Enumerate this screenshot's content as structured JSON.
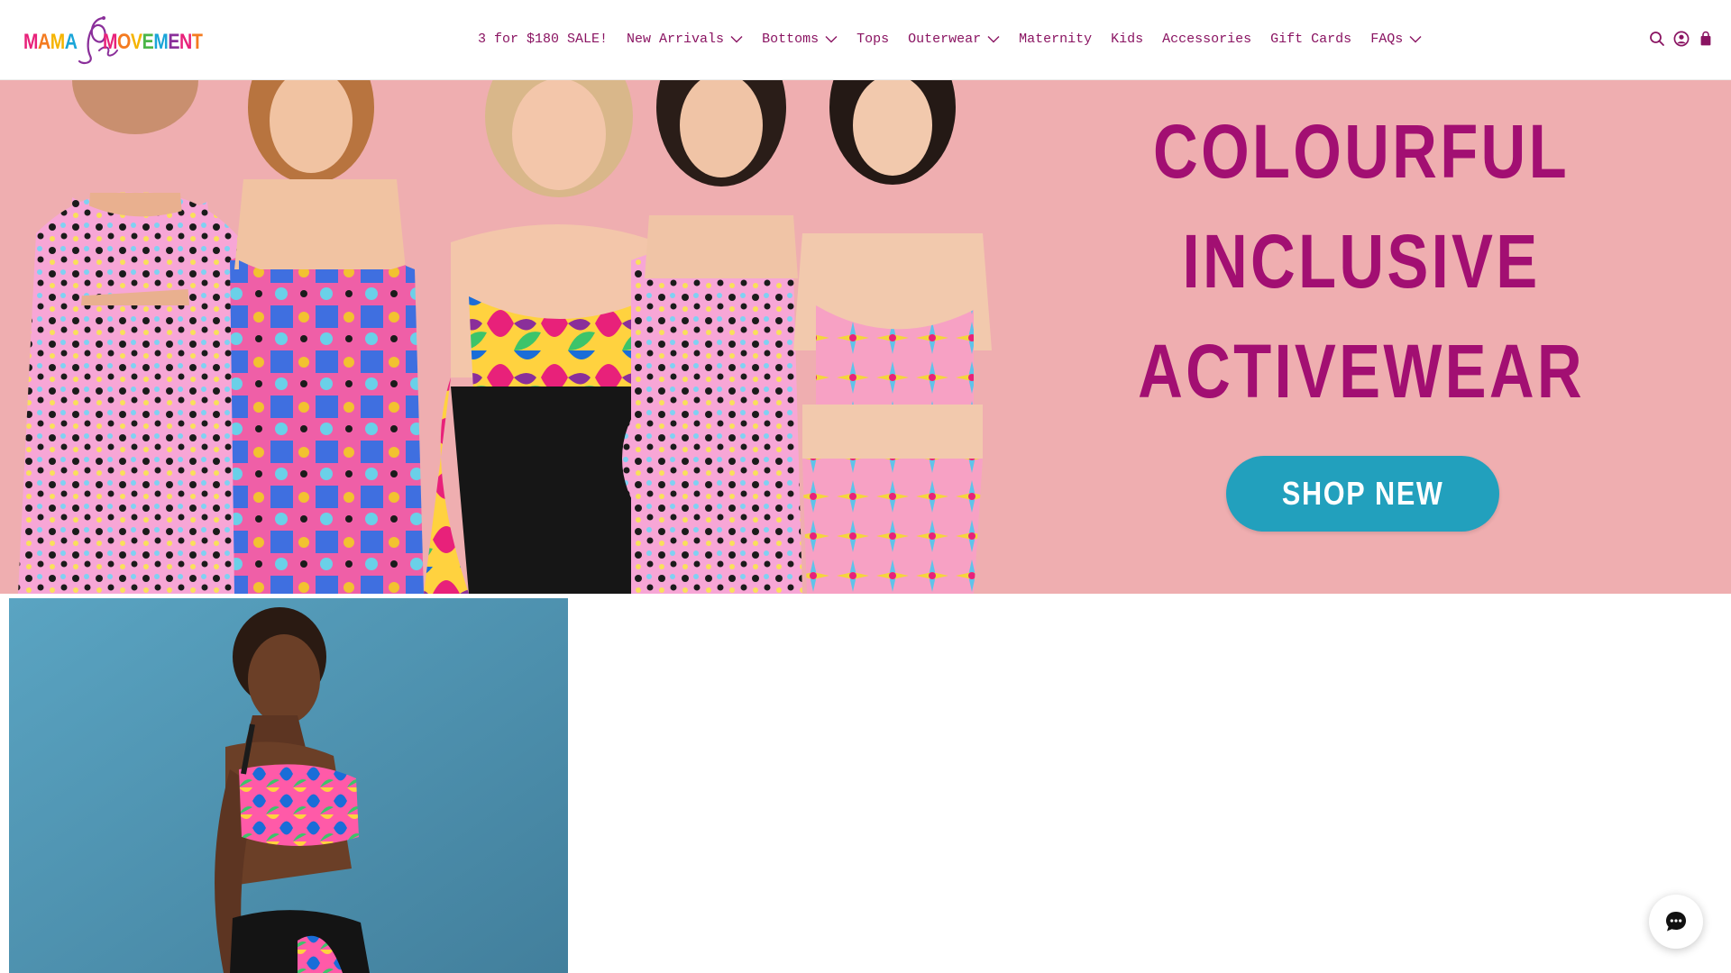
{
  "brand": {
    "logo_word_left": "MAMA",
    "logo_word_right": "MOVEMENT",
    "logo_colors": [
      "#e8217a",
      "#f47b20",
      "#f5b400",
      "#4bb648",
      "#1aa5d8",
      "#8a2f9a"
    ]
  },
  "nav": {
    "items": [
      {
        "label": "3 for $180 SALE!",
        "has_dropdown": false
      },
      {
        "label": "New Arrivals",
        "has_dropdown": true
      },
      {
        "label": "Bottoms",
        "has_dropdown": true
      },
      {
        "label": "Tops",
        "has_dropdown": false
      },
      {
        "label": "Outerwear",
        "has_dropdown": true
      },
      {
        "label": "Maternity",
        "has_dropdown": false
      },
      {
        "label": "Kids",
        "has_dropdown": false
      },
      {
        "label": "Accessories",
        "has_dropdown": false
      },
      {
        "label": "Gift Cards",
        "has_dropdown": false
      },
      {
        "label": "FAQs",
        "has_dropdown": true
      }
    ],
    "color": "#8a1462"
  },
  "header_icons": [
    "search-icon",
    "account-icon",
    "cart-icon"
  ],
  "hero": {
    "headline_line1": "COLOURFUL",
    "headline_line2": "INCLUSIVE",
    "headline_line3": "ACTIVEWEAR",
    "cta_label": "SHOP NEW",
    "background_color": "#efaeb0",
    "headline_color": "#a20f72",
    "cta_color": "#22a0bd"
  },
  "product_tile": {
    "background_color": "#4e9bba"
  },
  "chat": {
    "icon": "chat-bubble-icon"
  }
}
